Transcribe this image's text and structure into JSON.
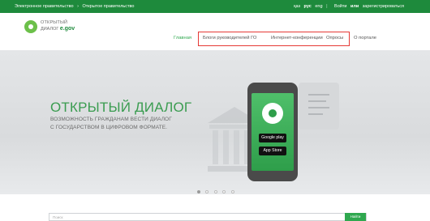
{
  "topbar": {
    "crumb_1": "Электронное правительство",
    "crumb_sep": "›",
    "crumb_2": "Открытое правительство",
    "lang_kaz": "қаз",
    "lang_rus": "рус",
    "lang_eng": "eng",
    "divider": "|",
    "login": "Войти",
    "or": "или",
    "register": "зарегистрироваться"
  },
  "logo": {
    "line1": "ОТКРЫТЫЙ",
    "line2": "ДИАЛОГ",
    "brand": "e.gov"
  },
  "nav": {
    "home": "Главная",
    "blogs": "Блоги руководителей ГО",
    "conferences": "Интернет-конференции",
    "polls": "Опросы",
    "about": "О портале"
  },
  "hero": {
    "title": "ОТКРЫТЫЙ ДИАЛОГ",
    "line1": "ВОЗМОЖНОСТЬ ГРАЖДАНАМ ВЕСТИ ДИАЛОГ",
    "line2": "С ГОСУДАРСТВОМ В ЦИФРОВОМ ФОРМАТЕ.",
    "store_google": "Google play",
    "store_apple": "App Store",
    "slides_total": 5,
    "slide_active": 1
  },
  "search": {
    "placeholder": "Поиск",
    "button": "Найти"
  },
  "colors": {
    "brand_green": "#1e8a3c",
    "accent_green": "#2fa84f",
    "highlight_red": "#e53935"
  }
}
